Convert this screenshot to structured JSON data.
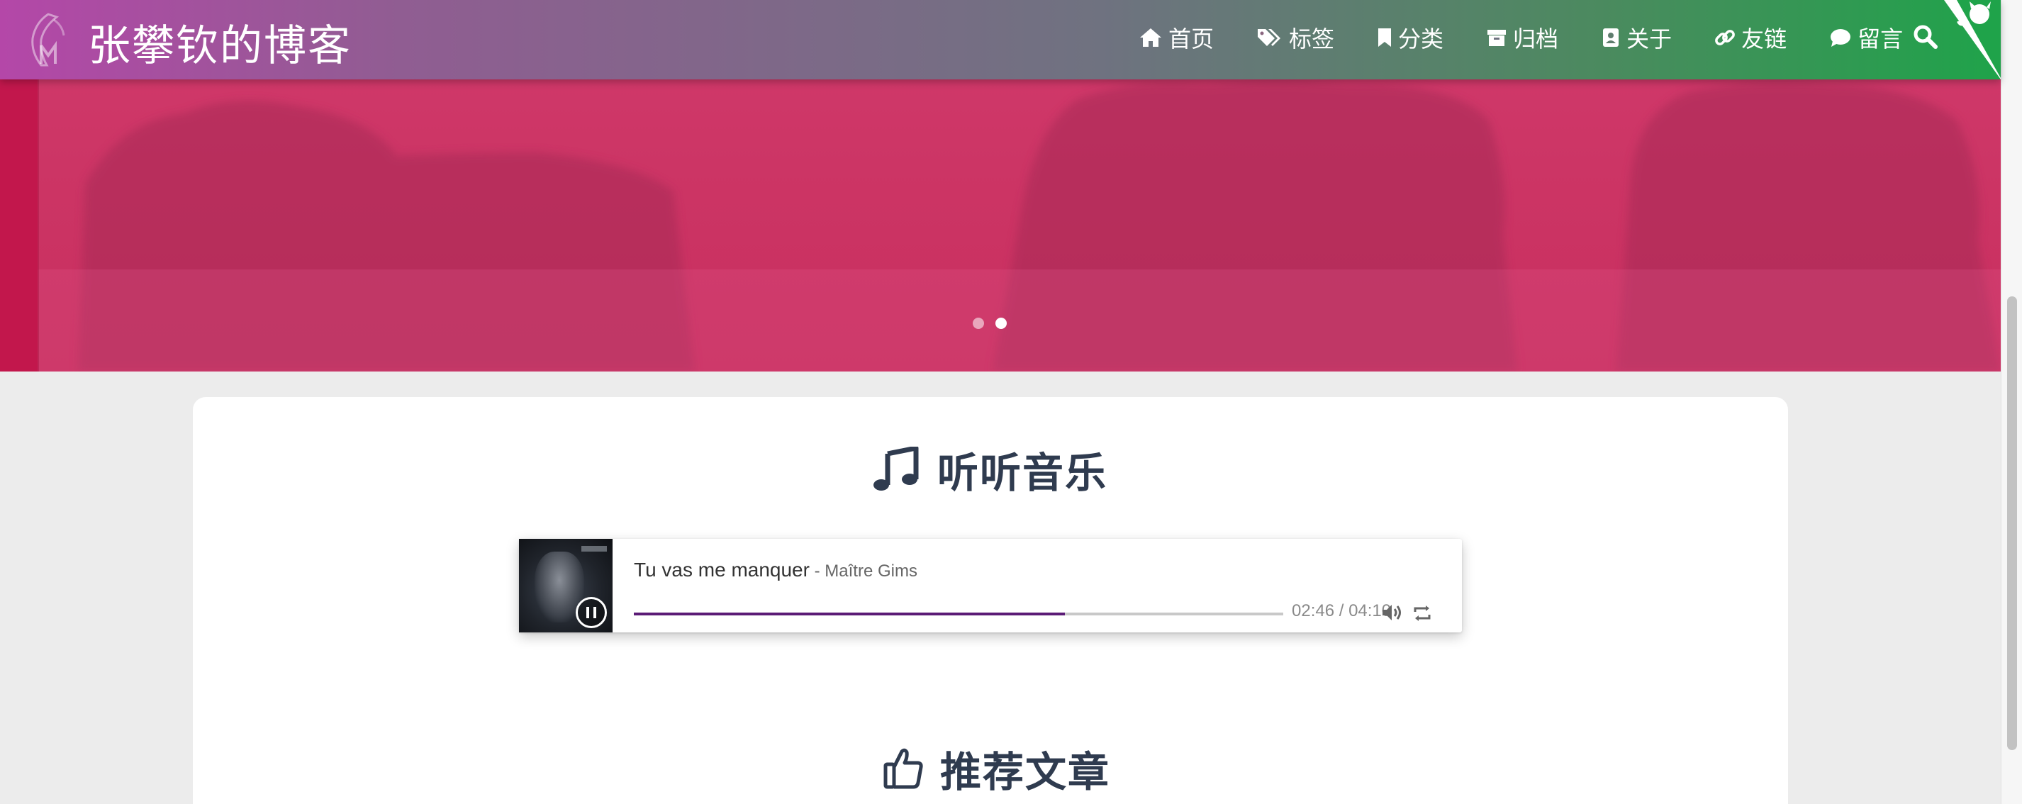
{
  "site": {
    "brand": "张攀钦的博客"
  },
  "nav": {
    "items": [
      {
        "label": "首页",
        "icon": "home-icon"
      },
      {
        "label": "标签",
        "icon": "tags-icon"
      },
      {
        "label": "分类",
        "icon": "bookmark-icon"
      },
      {
        "label": "归档",
        "icon": "archive-icon"
      },
      {
        "label": "关于",
        "icon": "address-card-icon"
      },
      {
        "label": "友链",
        "icon": "link-icon"
      },
      {
        "label": "留言",
        "icon": "comment-icon"
      }
    ],
    "search_icon": "search-icon",
    "corner_icon": "github-octocat-icon"
  },
  "carousel": {
    "slides": 2,
    "active_index": 1,
    "overlay_color": "#cc3565"
  },
  "sections": {
    "music": {
      "title": "听听音乐",
      "icon": "music-icon"
    },
    "recommended": {
      "title": "推荐文章",
      "icon": "thumbs-up-icon"
    }
  },
  "player": {
    "song_title": "Tu vas me manquer",
    "artist": " - Maître Gims",
    "time": "02:46 / 04:10",
    "progress_fraction": 0.664,
    "progress_color": "#5b1b76",
    "icons": {
      "pause": "pause-icon",
      "volume": "volume-icon",
      "loop": "loop-icon"
    }
  },
  "colors": {
    "nav_start": "#b447a8",
    "nav_end": "#1fa34a",
    "title_text": "#2f3b4f"
  }
}
